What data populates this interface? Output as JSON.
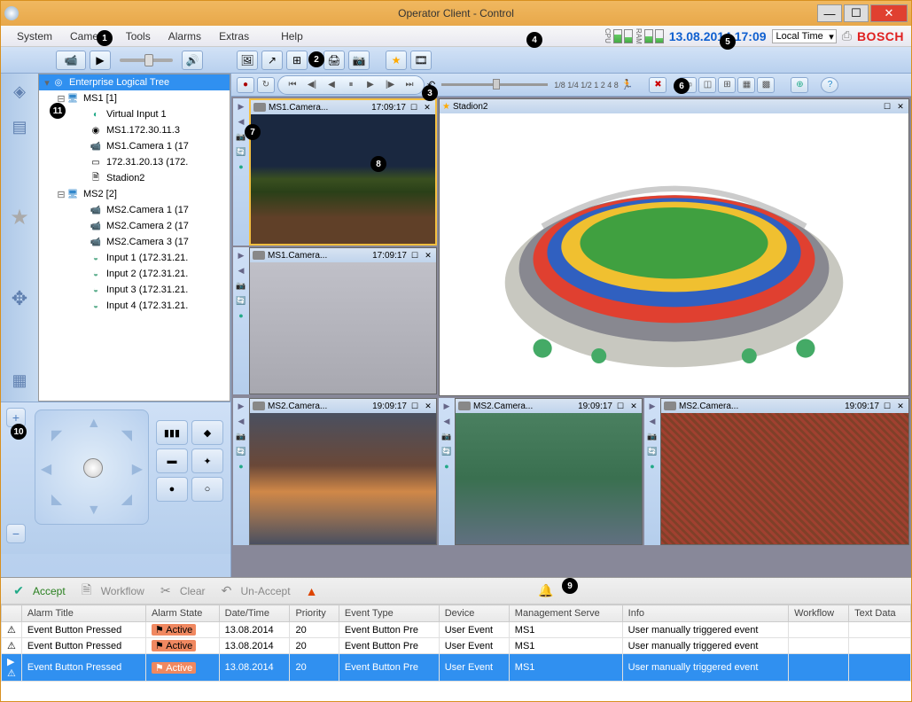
{
  "window": {
    "title": "Operator Client - Control"
  },
  "menu": {
    "system": "System",
    "camera": "Camera",
    "tools": "Tools",
    "alarms": "Alarms",
    "extras": "Extras",
    "help": "Help"
  },
  "header": {
    "datetime": "13.08.2014 17:09",
    "timezone": "Local Time",
    "brand": "BOSCH",
    "cpu": "CPU",
    "ram": "RAM"
  },
  "playback": {
    "speeds": "1/8 1/4 1/2  1   2   4   8"
  },
  "tree": {
    "root": "Enterprise Logical Tree",
    "ms1": {
      "label": "MS1 [1]",
      "vi1": "Virtual Input 1",
      "ip1": "MS1.172.30.11.3",
      "cam1": "MS1.Camera 1 (17",
      "ip2": "172.31.20.13 (172.",
      "stadion": "Stadion2"
    },
    "ms2": {
      "label": "MS2 [2]",
      "cam1": "MS2.Camera 1 (17",
      "cam2": "MS2.Camera 2 (17",
      "cam3": "MS2.Camera 3 (17",
      "in1": "Input 1 (172.31.21.",
      "in2": "Input 2 (172.31.21.",
      "in3": "Input 3 (172.31.21.",
      "in4": "Input 4 (172.31.21."
    }
  },
  "cams": {
    "c1": {
      "name": "MS1.Camera...",
      "time": "17:09:17"
    },
    "big": {
      "name": "Stadion2"
    },
    "c2": {
      "name": "MS1.Camera...",
      "time": "17:09:17"
    },
    "c3": {
      "name": "MS2.Camera...",
      "time": "19:09:17"
    },
    "c4": {
      "name": "MS2.Camera...",
      "time": "19:09:17"
    },
    "c5": {
      "name": "MS2.Camera...",
      "time": "19:09:17"
    }
  },
  "alarms": {
    "accept": "Accept",
    "workflow": "Workflow",
    "clear": "Clear",
    "unaccept": "Un-Accept",
    "cols": {
      "title": "Alarm Title",
      "state": "Alarm State",
      "dt": "Date/Time",
      "prio": "Priority",
      "etype": "Event Type",
      "device": "Device",
      "server": "Management Serve",
      "info": "Info",
      "wf": "Workflow",
      "txt": "Text Data"
    },
    "rows": [
      {
        "title": "Event Button Pressed",
        "state": "Active",
        "dt": "13.08.2014",
        "prio": "20",
        "etype": "Event Button Pre",
        "device": "User Event",
        "server": "MS1",
        "info": "User manually triggered event"
      },
      {
        "title": "Event Button Pressed",
        "state": "Active",
        "dt": "13.08.2014",
        "prio": "20",
        "etype": "Event Button Pre",
        "device": "User Event",
        "server": "MS1",
        "info": "User manually triggered event"
      },
      {
        "title": "Event Button Pressed",
        "state": "Active",
        "dt": "13.08.2014",
        "prio": "20",
        "etype": "Event Button Pre",
        "device": "User Event",
        "server": "MS1",
        "info": "User manually triggered event"
      }
    ]
  },
  "numbers": [
    "1",
    "2",
    "3",
    "4",
    "5",
    "6",
    "7",
    "8",
    "9",
    "10",
    "11"
  ]
}
